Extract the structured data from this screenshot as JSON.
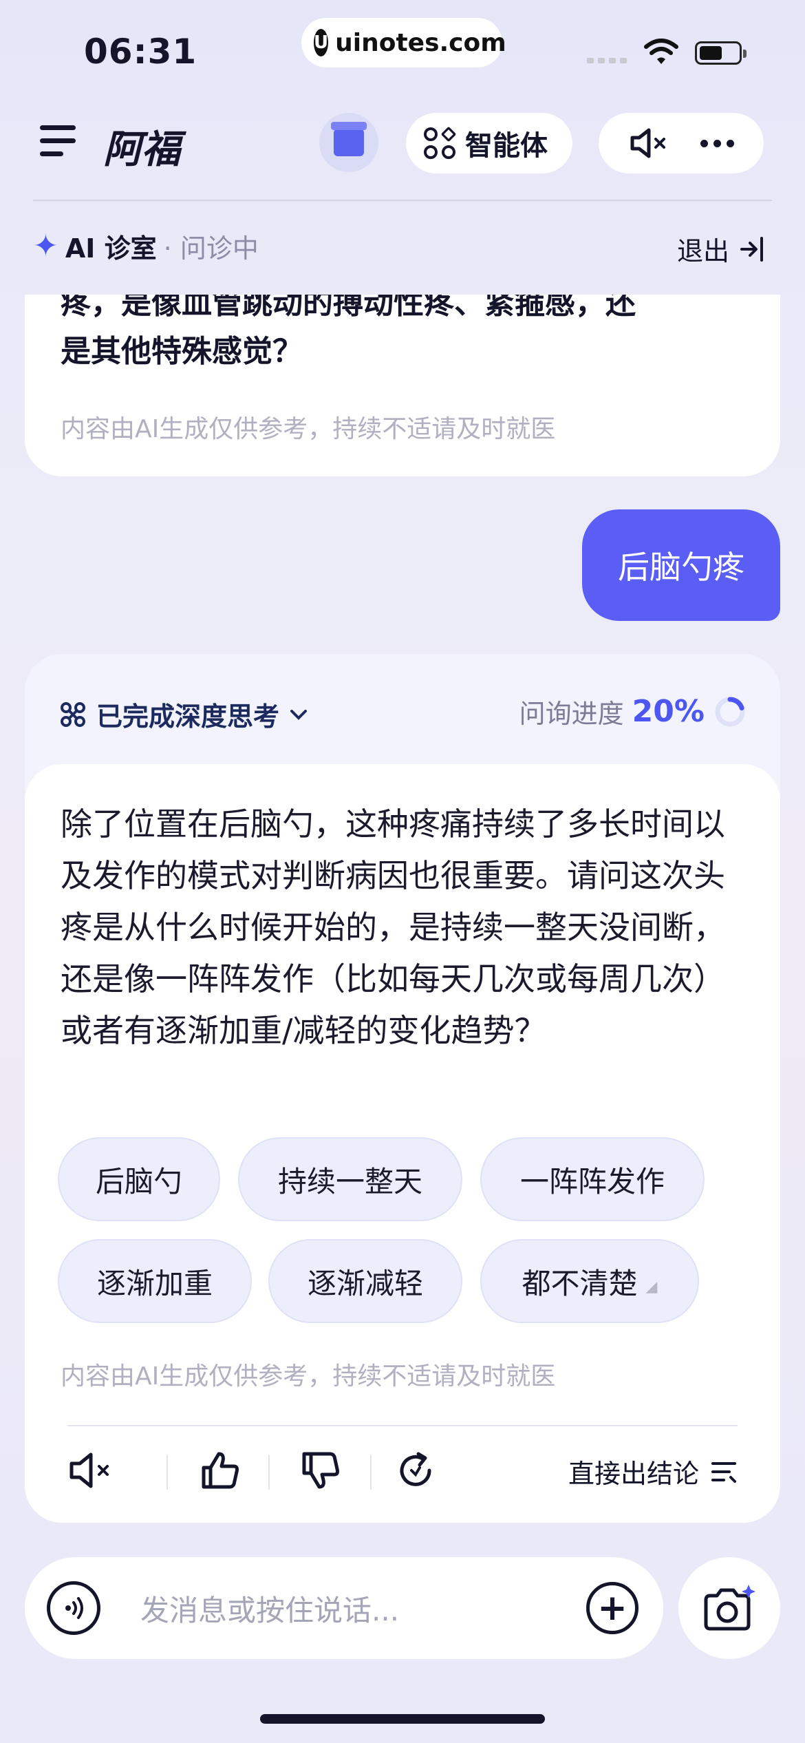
{
  "status_bar": {
    "time": "06:31",
    "url": "uinotes.com"
  },
  "header": {
    "brand": "阿福",
    "agent_label": "智能体",
    "icons": [
      "menu-icon",
      "gift-icon",
      "agent-icon",
      "mute-icon",
      "more-icon"
    ]
  },
  "ai_room": {
    "title": "AI 诊室",
    "status": "· 问诊中",
    "exit_label": "退出"
  },
  "previous_message": {
    "partial_line": "疼，是像血管跳动的搏动性疼、紧箍感，还",
    "last_line": "是其他特殊感觉？",
    "disclaimer": "内容由AI生成仅供参考，持续不适请及时就医"
  },
  "user_message": {
    "text": "后脑勺疼"
  },
  "answer": {
    "thinking_label": "已完成深度思考",
    "progress_label": "问询进度",
    "progress_value": "20%",
    "progress_fraction": 0.2,
    "text": "除了位置在后脑勺，这种疼痛持续了多长时间以及发作的模式对判断病因也很重要。请问这次头疼是从什么时候开始的，是持续一整天没间断，还是像一阵阵发作（比如每天几次或每周几次）或者有逐渐加重/减轻的变化趋势？",
    "chips": [
      "后脑勺",
      "持续一整天",
      "一阵阵发作",
      "逐渐加重",
      "逐渐减轻",
      "都不清楚"
    ],
    "disclaimer": "内容由AI生成仅供参考，持续不适请及时就医",
    "conclude_label": "直接出结论"
  },
  "input": {
    "placeholder": "发消息或按住说话..."
  },
  "colors": {
    "accent": "#5a5ef5",
    "brand_blue": "#4b57f0",
    "text": "#14142b"
  }
}
